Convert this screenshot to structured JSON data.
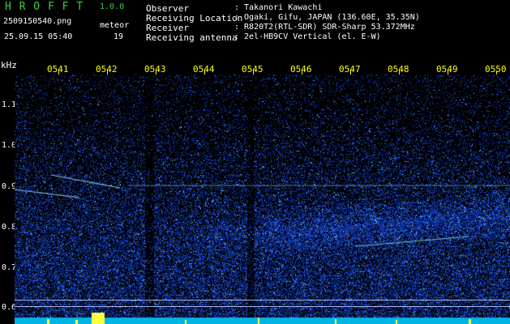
{
  "app": {
    "name": "H R O F F T",
    "version": "1.0.0"
  },
  "file": {
    "name": "2509150540.png",
    "datetime": "25.09.15 05:40"
  },
  "meteor": {
    "label": "meteor",
    "count": "19"
  },
  "info": [
    {
      "label": "Observer",
      "value": ": Takanori Kawachi"
    },
    {
      "label": "Receiving Location",
      "value": ": Ogaki, Gifu, JAPAN (136.60E, 35.35N)"
    },
    {
      "label": "Receiver",
      "value": ": R820T2(RTL-SDR) SDR-Sharp 53.372MHz"
    },
    {
      "label": "Receiving antenna",
      "value": ": 2el-HB9CV Vertical (el. E-W)"
    }
  ],
  "axis": {
    "unit": "kHz",
    "freq_labels": [
      "1.1",
      "1.0",
      "0.9",
      "0.8",
      "0.7",
      "0.6"
    ],
    "minute_labels": [
      "0541",
      "0542",
      "0543",
      "0544",
      "0545",
      "0546",
      "0547",
      "0548",
      "0549",
      "0550"
    ]
  },
  "colors": {
    "title_green": "#3cd23c",
    "minute_yellow": "#ffff00",
    "background": "#000000",
    "noise_blue": "#1e3cc8",
    "echo_cyan": "#50c8ff",
    "baseline_cyan": "#00c8ff"
  }
}
